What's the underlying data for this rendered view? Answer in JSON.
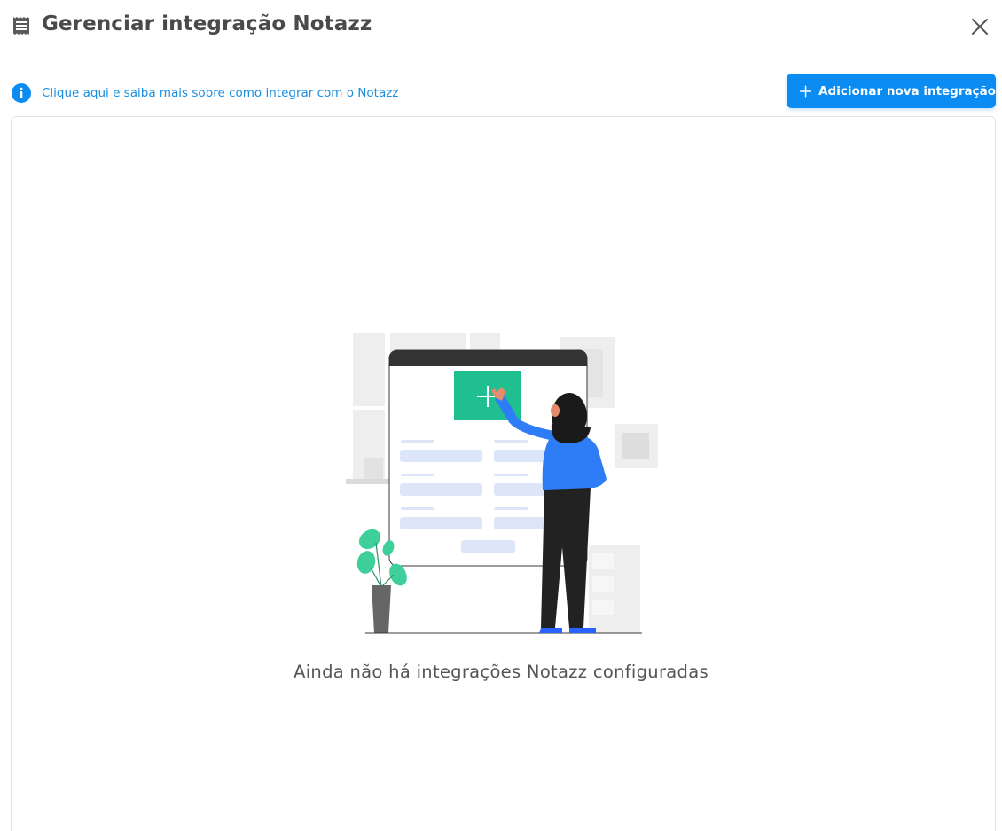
{
  "header": {
    "title": "Gerenciar integração Notazz",
    "title_icon": "receipt-icon",
    "close_icon": "close-icon"
  },
  "info": {
    "icon": "info-icon",
    "link_text": "Clique aqui e saiba mais sobre como integrar com o Notazz"
  },
  "toolbar": {
    "add_button_label": "Adicionar nova integração",
    "add_button_icon": "plus-icon"
  },
  "empty_state": {
    "message": "Ainda não há integrações Notazz configuradas"
  },
  "colors": {
    "primary": "#0a8cf2",
    "link": "#1a8fe0",
    "annotation_arrow": "#22dd11",
    "illustration_accent": "#1fbf8f"
  }
}
